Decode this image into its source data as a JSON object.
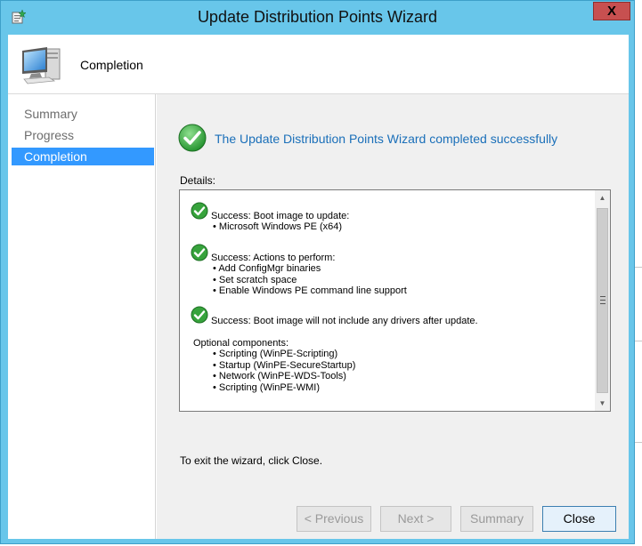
{
  "window": {
    "title": "Update Distribution Points Wizard",
    "close_label": "X"
  },
  "header": {
    "title": "Completion"
  },
  "nav": {
    "items": [
      {
        "label": "Summary",
        "active": false
      },
      {
        "label": "Progress",
        "active": false
      },
      {
        "label": "Completion",
        "active": true
      }
    ]
  },
  "main": {
    "status_message": "The Update Distribution Points Wizard completed successfully",
    "details_label": "Details:",
    "details": {
      "sections": [
        {
          "success": "Success: Boot image to update:",
          "bullets": [
            "Microsoft Windows PE (x64)"
          ]
        },
        {
          "success": "Success: Actions to perform:",
          "bullets": [
            "Add ConfigMgr binaries",
            "Set scratch space",
            "Enable Windows PE command line support"
          ]
        },
        {
          "success": "Success: Boot image will not include any drivers after update.",
          "bullets": []
        }
      ],
      "optional_label": "Optional components:",
      "optional_items": [
        "Scripting (WinPE-Scripting)",
        "Startup (WinPE-SecureStartup)",
        "Network (WinPE-WDS-Tools)",
        "Scripting (WinPE-WMI)"
      ]
    },
    "exit_text": "To exit the wizard, click Close."
  },
  "buttons": {
    "previous": "< Previous",
    "next": "Next >",
    "summary": "Summary",
    "close": "Close"
  },
  "colors": {
    "accent": "#3399ff",
    "title_bar": "#68c6ea",
    "status_text": "#1a6fb9",
    "success_green": "#2e9d2e",
    "close_red": "#c75050"
  },
  "icons": {
    "app": "wizard-app-icon",
    "header": "computer-icon",
    "status": "success-check-icon"
  }
}
